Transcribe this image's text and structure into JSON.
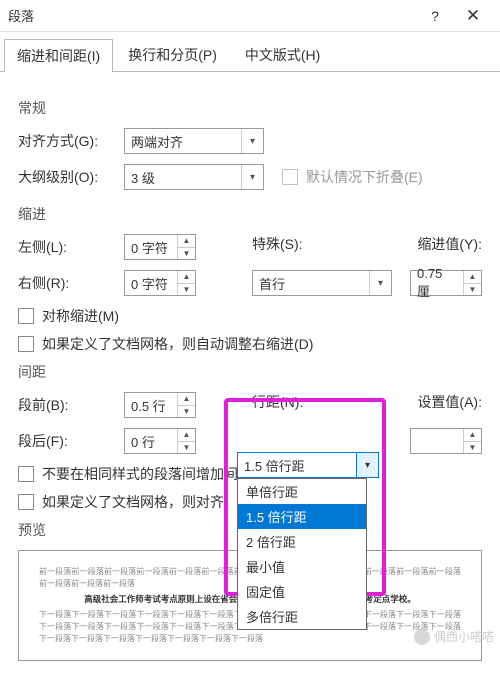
{
  "window": {
    "title": "段落",
    "help": "?",
    "close": "✕"
  },
  "tabs": {
    "t1": "缩进和间距(I)",
    "t2": "换行和分页(P)",
    "t3": "中文版式(H)"
  },
  "sections": {
    "general": "常规",
    "indent": "缩进",
    "spacing": "间距",
    "preview": "预览"
  },
  "labels": {
    "alignment": "对齐方式(G):",
    "outline": "大纲级别(O):",
    "collapse": "默认情况下折叠(E)",
    "left": "左侧(L):",
    "right": "右侧(R):",
    "special": "特殊(S):",
    "indentval": "缩进值(Y):",
    "mirror": "对称缩进(M)",
    "autoind": "如果定义了文档网格，则自动调整右缩进(D)",
    "before": "段前(B):",
    "after": "段后(F):",
    "linespace": "行距(N):",
    "setval": "设置值(A):",
    "nosame": "不要在相同样式的段落间增加间距",
    "autogrid": "如果定义了文档网格，则对齐"
  },
  "values": {
    "alignment": "两端对齐",
    "outline": "3 级",
    "left": "0 字符",
    "right": "0 字符",
    "special": "首行",
    "indentval": "0.75 厘",
    "before": "0.5 行",
    "after": "0 行",
    "linespace_sel": "1.5 倍行距",
    "setval": ""
  },
  "linespace_options": [
    "单倍行距",
    "1.5 倍行距",
    "2 倍行距",
    "最小值",
    "固定值",
    "多倍行距"
  ],
  "preview": {
    "p1": "前一段落前一段落前一段落前一段落前一段落前一段落前一段落前一段落前一段落前一段落前一段落前一段落前一段落前一段落前一段落前一段落",
    "p2": "高级社会工作师考试考点原则上设在省会城市和直辖市的大、中专院校或高考定点学校。",
    "p3": "下一段落下一段落下一段落下一段落下一段落下一段落下一段落下一段落下一段落下一段落下一段落下一段落下一段落下一段落下一段落下一段落下一段落下一段落下一段落下一段落下一段落下一段落下一段落下一段落下一段落下一段落下一段落下一段落下一段落下一段落下一段落下一段落下一段落"
  },
  "watermark": "偶西小嗒嗒"
}
